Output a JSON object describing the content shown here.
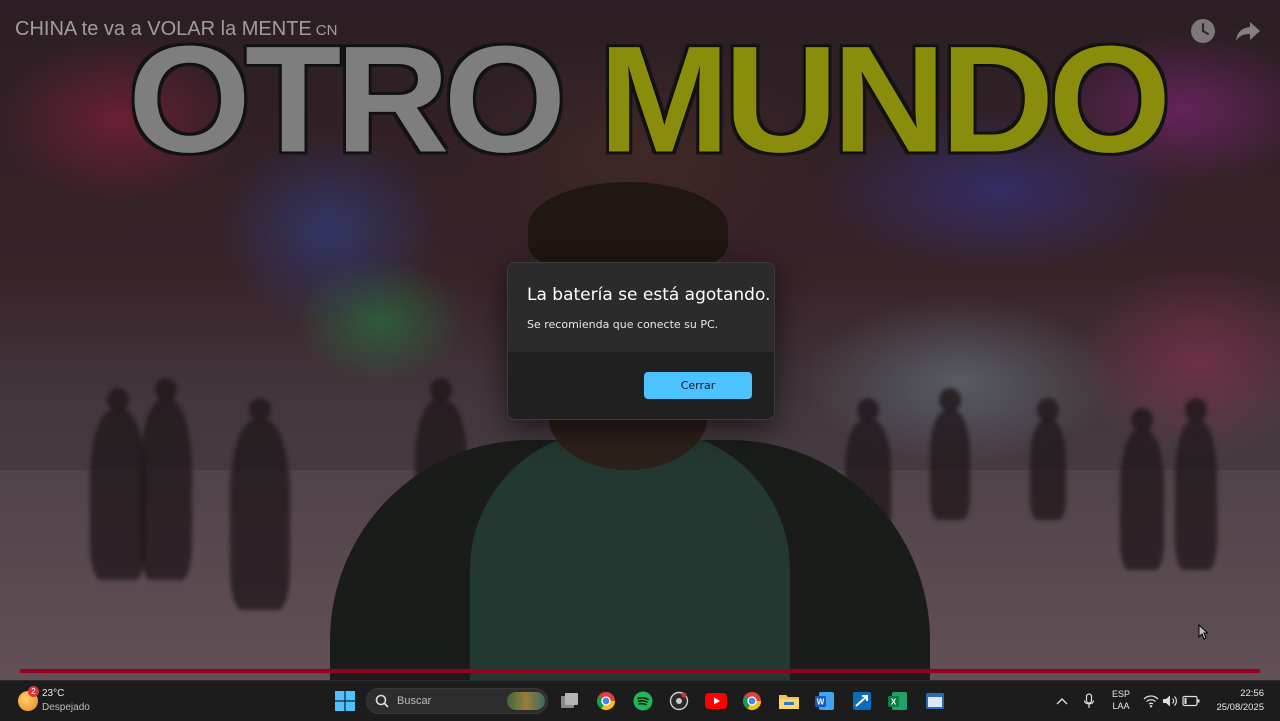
{
  "video": {
    "title": "CHINA te va a VOLAR la MENTE",
    "title_suffix": "CN",
    "headline_word1": "OTRO",
    "headline_word2": "MUNDO",
    "progress_fraction": 1.0,
    "progress_color": "#c4002a"
  },
  "dialog": {
    "title": "La batería se está agotando.",
    "message": "Se recomienda que conecte su PC.",
    "close_label": "Cerrar",
    "accent_color": "#4cc2ff"
  },
  "taskbar": {
    "weather": {
      "temp": "23°C",
      "condition": "Despejado",
      "badge": "2"
    },
    "search_placeholder": "Buscar",
    "apps": [
      "windows-start-icon",
      "task-view-icon",
      "chrome-icon",
      "spotify-icon",
      "app-icon",
      "youtube-icon",
      "chrome-alt-icon",
      "file-explorer-icon",
      "word-icon",
      "remote-desktop-icon",
      "excel-icon",
      "window-app-icon"
    ],
    "tray": {
      "lang1": "ESP",
      "lang2": "LAA"
    },
    "clock": {
      "time": "22:56",
      "date": "25/08/2025"
    }
  }
}
